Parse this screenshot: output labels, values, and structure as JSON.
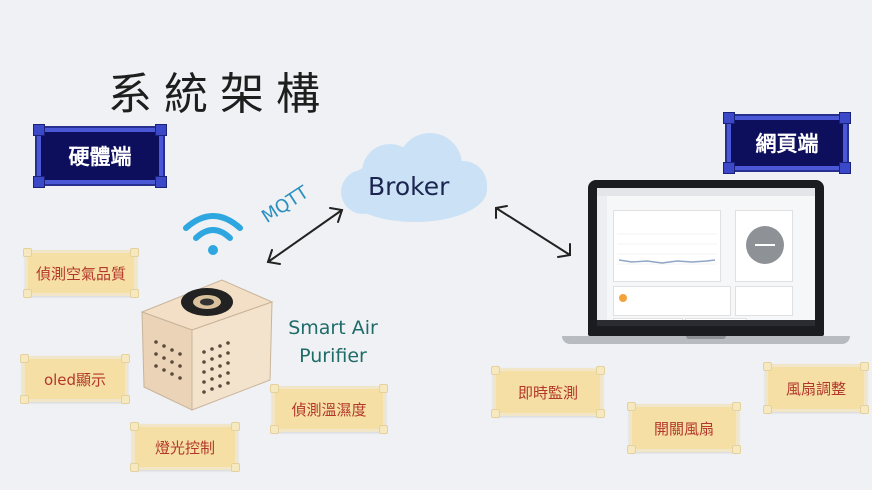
{
  "title": "系統架構",
  "hardware_label": "硬體端",
  "web_label": "網頁端",
  "broker_label": "Broker",
  "mqtt_label": "MQTT",
  "device_name_line1": "Smart Air",
  "device_name_line2": "Purifier",
  "hardware_features": [
    "偵測空氣品質",
    "oled顯示",
    "燈光控制",
    "偵測溫濕度"
  ],
  "web_features": [
    "即時監測",
    "開關風扇",
    "風扇調整"
  ],
  "colors": {
    "background": "#eff1f4",
    "label_bg": "#0d0e5c",
    "label_border": "#4a58d8",
    "note_bg": "#f6dfa4",
    "note_text": "#b3372b",
    "cloud": "#cbe2f6",
    "mqtt_text": "#2b8fbf",
    "device_text": "#1f6b68",
    "wifi": "#2ea6e0"
  }
}
